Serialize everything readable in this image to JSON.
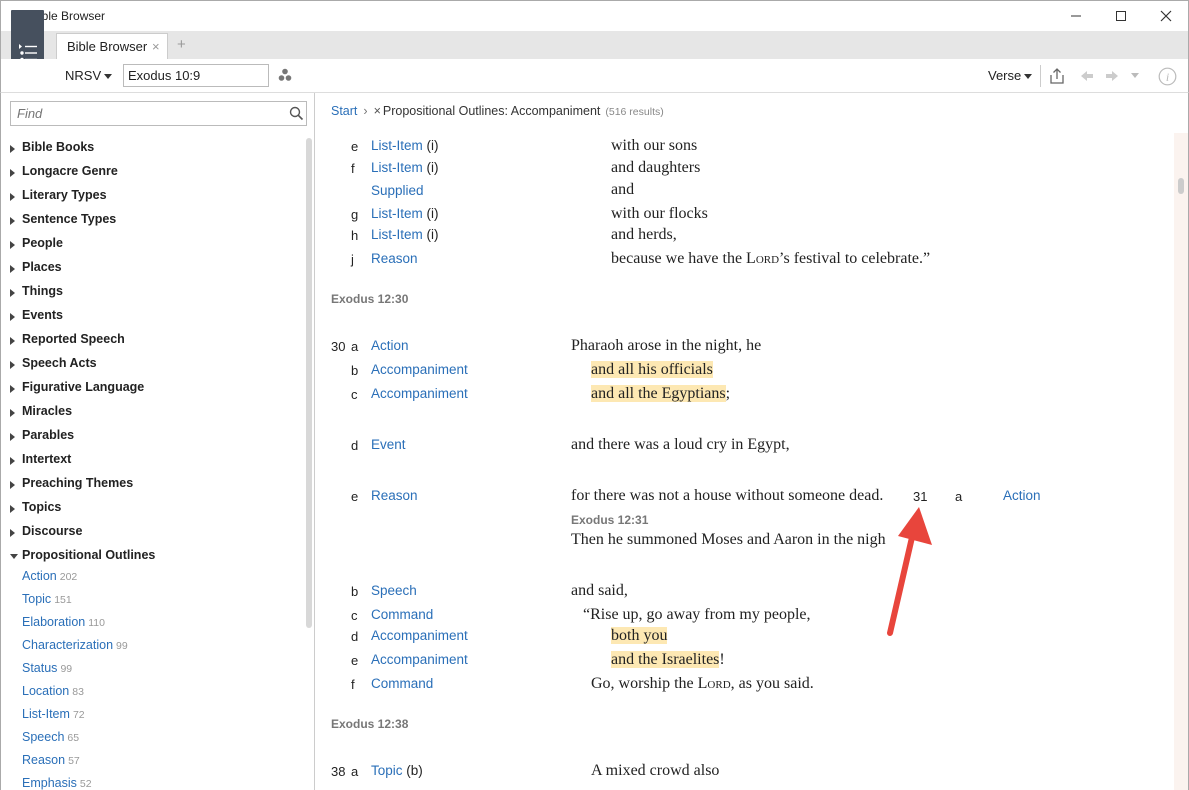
{
  "window": {
    "title": "Bible Browser"
  },
  "tabs": [
    {
      "label": "Bible Browser",
      "close": "×"
    }
  ],
  "tab_add": "+",
  "toolbar": {
    "version": "NRSV",
    "reference": "Exodus 10:9",
    "verse_mode": "Verse"
  },
  "sidebar": {
    "find_placeholder": "Find",
    "categories": [
      "Bible Books",
      "Longacre Genre",
      "Literary Types",
      "Sentence Types",
      "People",
      "Places",
      "Things",
      "Events",
      "Reported Speech",
      "Speech Acts",
      "Figurative Language",
      "Miracles",
      "Parables",
      "Intertext",
      "Preaching Themes",
      "Topics",
      "Discourse",
      "Propositional Outlines"
    ],
    "subitems": [
      {
        "label": "Action",
        "count": "202"
      },
      {
        "label": "Topic",
        "count": "151"
      },
      {
        "label": "Elaboration",
        "count": "110"
      },
      {
        "label": "Characterization",
        "count": "99"
      },
      {
        "label": "Status",
        "count": "99"
      },
      {
        "label": "Location",
        "count": "83"
      },
      {
        "label": "List-Item",
        "count": "72"
      },
      {
        "label": "Speech",
        "count": "65"
      },
      {
        "label": "Reason",
        "count": "57"
      },
      {
        "label": "Emphasis",
        "count": "52"
      }
    ]
  },
  "breadcrumb": {
    "start": "Start",
    "sep": "›",
    "x": "×",
    "current": "Propositional Outlines: Accompaniment",
    "results": "(516 results)"
  },
  "content": {
    "rows_top": [
      {
        "letter": "e",
        "cls": "List-Item",
        "paren": "(i)",
        "text": "with our sons"
      },
      {
        "letter": "f",
        "cls": "List-Item",
        "paren": "(i)",
        "text": "and daughters"
      },
      {
        "letter": "",
        "cls": "Supplied",
        "paren": "",
        "text": "and"
      },
      {
        "letter": "g",
        "cls": "List-Item",
        "paren": "(i)",
        "text": "with our flocks"
      },
      {
        "letter": "h",
        "cls": "List-Item",
        "paren": "(i)",
        "text": "and herds,"
      },
      {
        "letter": "j",
        "cls": "Reason",
        "paren": "",
        "text_pre": "because we have the ",
        "lord": "Lord",
        "text_post": "’s festival to celebrate.”"
      }
    ],
    "section1": "Exodus 12:30",
    "v30": {
      "num": "30",
      "a": {
        "letter": "a",
        "cls": "Action",
        "text": "Pharaoh arose in the night, he"
      },
      "b": {
        "letter": "b",
        "cls": "Accompaniment",
        "text": "and all his officials"
      },
      "c": {
        "letter": "c",
        "cls": "Accompaniment",
        "text": "and all the Egyptians",
        "punct": ";"
      },
      "d": {
        "letter": "d",
        "cls": "Event",
        "text": "and there was a loud cry in Egypt,"
      },
      "e": {
        "letter": "e",
        "cls": "Reason",
        "text": "for there was not a house without someone dead.",
        "num31": "31",
        "a31": "a",
        "cls31": "Action"
      }
    },
    "section2": "Exodus 12:31",
    "v31": {
      "line": "Then he summoned Moses and Aaron in the nigh",
      "b": {
        "letter": "b",
        "cls": "Speech",
        "text": "and said,"
      },
      "c": {
        "letter": "c",
        "cls": "Command",
        "text": "“Rise up, go away from my people,"
      },
      "d": {
        "letter": "d",
        "cls": "Accompaniment",
        "text": "both you"
      },
      "e": {
        "letter": "e",
        "cls": "Accompaniment",
        "text": "and the Israelites",
        "punct": "!"
      },
      "f": {
        "letter": "f",
        "cls": "Command",
        "text_pre": "Go, worship the ",
        "lord": "Lord",
        "text_post": ", as you said."
      }
    },
    "section3": "Exodus 12:38",
    "v38": {
      "num": "38",
      "letter": "a",
      "cls": "Topic",
      "paren": "(b)",
      "text": "A mixed crowd also"
    }
  },
  "colors": {
    "link": "#2a6fb8",
    "highlight": "#fde8b3",
    "arrow": "#e8453c",
    "panel_button": "#46505e"
  }
}
